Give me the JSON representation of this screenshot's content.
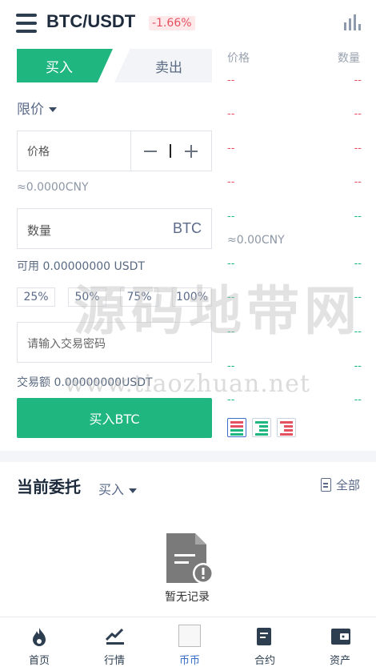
{
  "header": {
    "pair": "BTC/USDT",
    "change": "-1.66%"
  },
  "trade": {
    "tab_buy": "买入",
    "tab_sell": "卖出",
    "order_type": "限价",
    "price_label": "价格",
    "cny_estimate": "≈0.0000CNY",
    "qty_label": "数量",
    "qty_unit": "BTC",
    "available": "可用 0.00000000 USDT",
    "percents": [
      "25%",
      "50%",
      "75%",
      "100%"
    ],
    "password_placeholder": "请输入交易密码",
    "total": "交易额 0.00000000USDT",
    "buy_button": "买入BTC"
  },
  "orderbook": {
    "col_price": "价格",
    "col_qty": "数量",
    "asks": [
      [
        "--",
        "--"
      ],
      [
        "--",
        "--"
      ],
      [
        "--",
        "--"
      ],
      [
        "--",
        "--"
      ],
      [
        "--",
        "--"
      ]
    ],
    "cny": "≈0.00CNY",
    "bids": [
      [
        "--",
        "--"
      ],
      [
        "--",
        "--"
      ],
      [
        "--",
        "--"
      ],
      [
        "--",
        "--"
      ],
      [
        "--",
        "--"
      ]
    ]
  },
  "orders": {
    "title": "当前委托",
    "filter": "买入",
    "all": "全部",
    "empty": "暂无记录"
  },
  "watermark": {
    "line1": "源码地带网",
    "line2": "www.tiaozhuan.net"
  },
  "nav": {
    "items": [
      {
        "label": "首页",
        "icon": "flame-icon"
      },
      {
        "label": "行情",
        "icon": "market-icon"
      },
      {
        "label": "币币",
        "icon": "broken-image-icon"
      },
      {
        "label": "合约",
        "icon": "contract-icon"
      },
      {
        "label": "资产",
        "icon": "wallet-icon"
      }
    ],
    "active_index": 2
  },
  "colors": {
    "buy": "#1fb67f",
    "sell": "#e45160",
    "active_nav": "#3a6fc8"
  }
}
